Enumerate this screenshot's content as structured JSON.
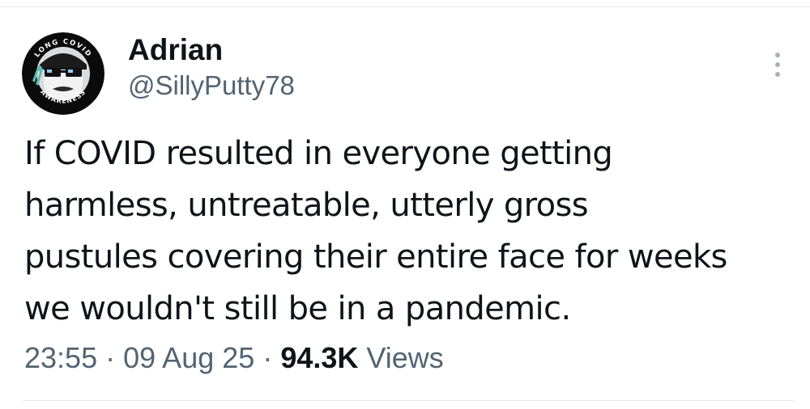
{
  "author": {
    "display_name": "Adrian",
    "handle": "@SillyPutty78",
    "avatar": {
      "badge_top_text": "LONG COVID",
      "badge_bottom_text": "AWARENESS",
      "ring_color": "#0b0b0b",
      "ribbon_color": "#5fb8b2"
    }
  },
  "tweet": {
    "text_lines": [
      "If COVID resulted in everyone getting",
      "harmless, untreatable, utterly gross",
      "pustules covering their entire face for weeks",
      "we wouldn't still be in a pandemic."
    ]
  },
  "meta": {
    "time": "23:55",
    "separator": "·",
    "date": "09 Aug 25",
    "views_count": "94.3K",
    "views_label": "Views"
  },
  "colors": {
    "primary_text": "#0f1419",
    "secondary_text": "#536471",
    "divider": "#e6e9eb"
  },
  "icons": {
    "more": "more-vertical-icon"
  }
}
